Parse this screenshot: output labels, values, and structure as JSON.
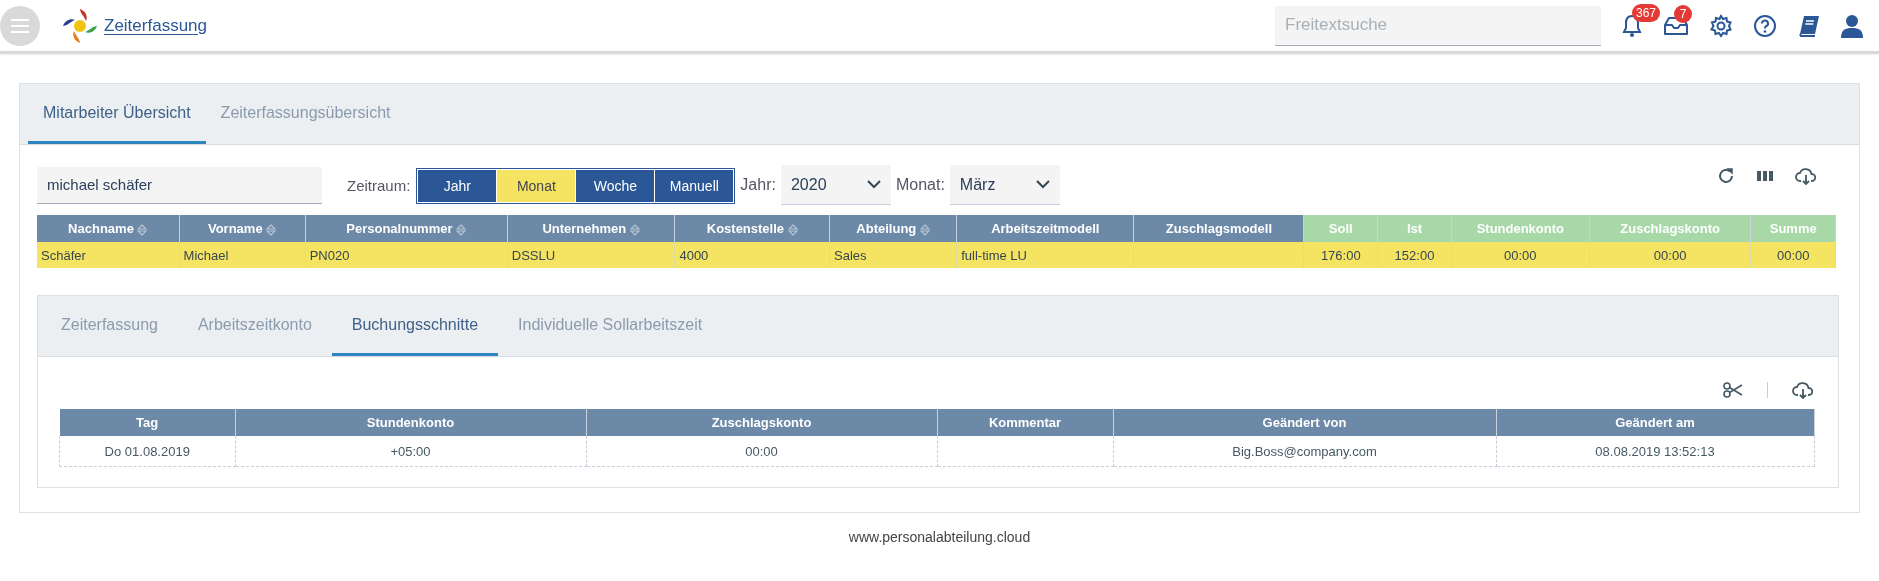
{
  "header": {
    "title": "Zeiterfassung",
    "search": {
      "placeholder": "Freitextsuche"
    },
    "notifications_badge": "367",
    "inbox_badge": "7"
  },
  "main_tabs": [
    {
      "label": "Mitarbeiter Übersicht",
      "selected": true
    },
    {
      "label": "Zeiterfassungsübersicht",
      "selected": false
    }
  ],
  "filter": {
    "employee_search": {
      "value": "michael schäfer"
    },
    "period_label": "Zeitraum:",
    "period_buttons": [
      {
        "label": "Jahr",
        "selected": false
      },
      {
        "label": "Monat",
        "selected": true
      },
      {
        "label": "Woche",
        "selected": false
      },
      {
        "label": "Manuell",
        "selected": false
      }
    ],
    "year": {
      "label": "Jahr:",
      "value": "2020"
    },
    "month": {
      "label": "Monat:",
      "value": "März"
    }
  },
  "employee_table": {
    "columns": [
      {
        "label": "Nachname",
        "kind": "base",
        "sortable": true
      },
      {
        "label": "Vorname",
        "kind": "base",
        "sortable": true
      },
      {
        "label": "Personalnummer",
        "kind": "base",
        "sortable": true
      },
      {
        "label": "Unternehmen",
        "kind": "base",
        "sortable": true
      },
      {
        "label": "Kostenstelle",
        "kind": "base",
        "sortable": true
      },
      {
        "label": "Abteilung",
        "kind": "base",
        "sortable": true
      },
      {
        "label": "Arbeitszeitmodell",
        "kind": "base",
        "sortable": false
      },
      {
        "label": "Zuschlagsmodell",
        "kind": "base",
        "sortable": false
      },
      {
        "label": "Soll",
        "kind": "total",
        "sortable": false
      },
      {
        "label": "Ist",
        "kind": "total",
        "sortable": false
      },
      {
        "label": "Stundenkonto",
        "kind": "total",
        "sortable": false
      },
      {
        "label": "Zuschlagskonto",
        "kind": "total",
        "sortable": false
      },
      {
        "label": "Summe",
        "kind": "total",
        "sortable": false
      }
    ],
    "rows": [
      {
        "selected": true,
        "cells": [
          "Schäfer",
          "Michael",
          "PN020",
          "DSSLU",
          "4000",
          "Sales",
          "full-time LU",
          "",
          "176:00",
          "152:00",
          "00:00",
          "00:00",
          "00:00"
        ]
      }
    ]
  },
  "detail_tabs": [
    {
      "label": "Zeiterfassung",
      "selected": false
    },
    {
      "label": "Arbeitszeitkonto",
      "selected": false
    },
    {
      "label": "Buchungsschnitte",
      "selected": true
    },
    {
      "label": "Individuelle Sollarbeitszeit",
      "selected": false
    }
  ],
  "bookings_table": {
    "columns": [
      "Tag",
      "Stundenkonto",
      "Zuschlagskonto",
      "Kommentar",
      "Geändert von",
      "Geändert am"
    ],
    "rows": [
      [
        "Do 01.08.2019",
        "+05:00",
        "00:00",
        "",
        "Big.Boss@company.com",
        "08.08.2019 13:52:13"
      ]
    ]
  },
  "footer": "www.personalabteilung.cloud"
}
